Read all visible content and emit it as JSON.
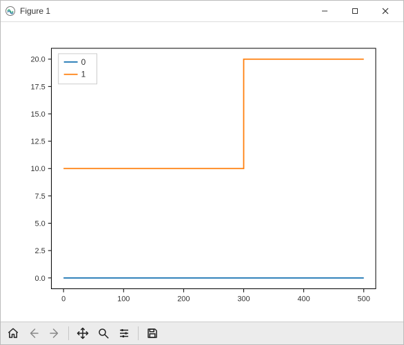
{
  "window": {
    "title": "Figure 1",
    "buttons": {
      "minimize": "Minimize",
      "maximize": "Maximize",
      "close": "Close"
    }
  },
  "toolbar": {
    "home": "Home",
    "back": "Back",
    "forward": "Forward",
    "pan": "Pan",
    "zoom": "Zoom",
    "subplots": "Configure subplots",
    "save": "Save"
  },
  "legend": {
    "items": [
      "0",
      "1"
    ]
  },
  "axes": {
    "xticks": [
      "0",
      "100",
      "200",
      "300",
      "400",
      "500"
    ],
    "yticks": [
      "0.0",
      "2.5",
      "5.0",
      "7.5",
      "10.0",
      "12.5",
      "15.0",
      "17.5",
      "20.0"
    ]
  },
  "colors": {
    "series0": "#1f77b4",
    "series1": "#ff7f0e",
    "frame": "#000000"
  },
  "chart_data": {
    "type": "line",
    "x": [
      0,
      300,
      300,
      500
    ],
    "series": [
      {
        "name": "0",
        "values": [
          0,
          0,
          0,
          0
        ],
        "color": "#1f77b4"
      },
      {
        "name": "1",
        "values": [
          10,
          10,
          20,
          20
        ],
        "color": "#ff7f0e"
      }
    ],
    "xlim": [
      -20,
      520
    ],
    "ylim": [
      -1,
      21
    ],
    "xlabel": "",
    "ylabel": "",
    "title": "",
    "legend_position": "upper left",
    "xticks": [
      0,
      100,
      200,
      300,
      400,
      500
    ],
    "yticks": [
      0.0,
      2.5,
      5.0,
      7.5,
      10.0,
      12.5,
      15.0,
      17.5,
      20.0
    ]
  }
}
